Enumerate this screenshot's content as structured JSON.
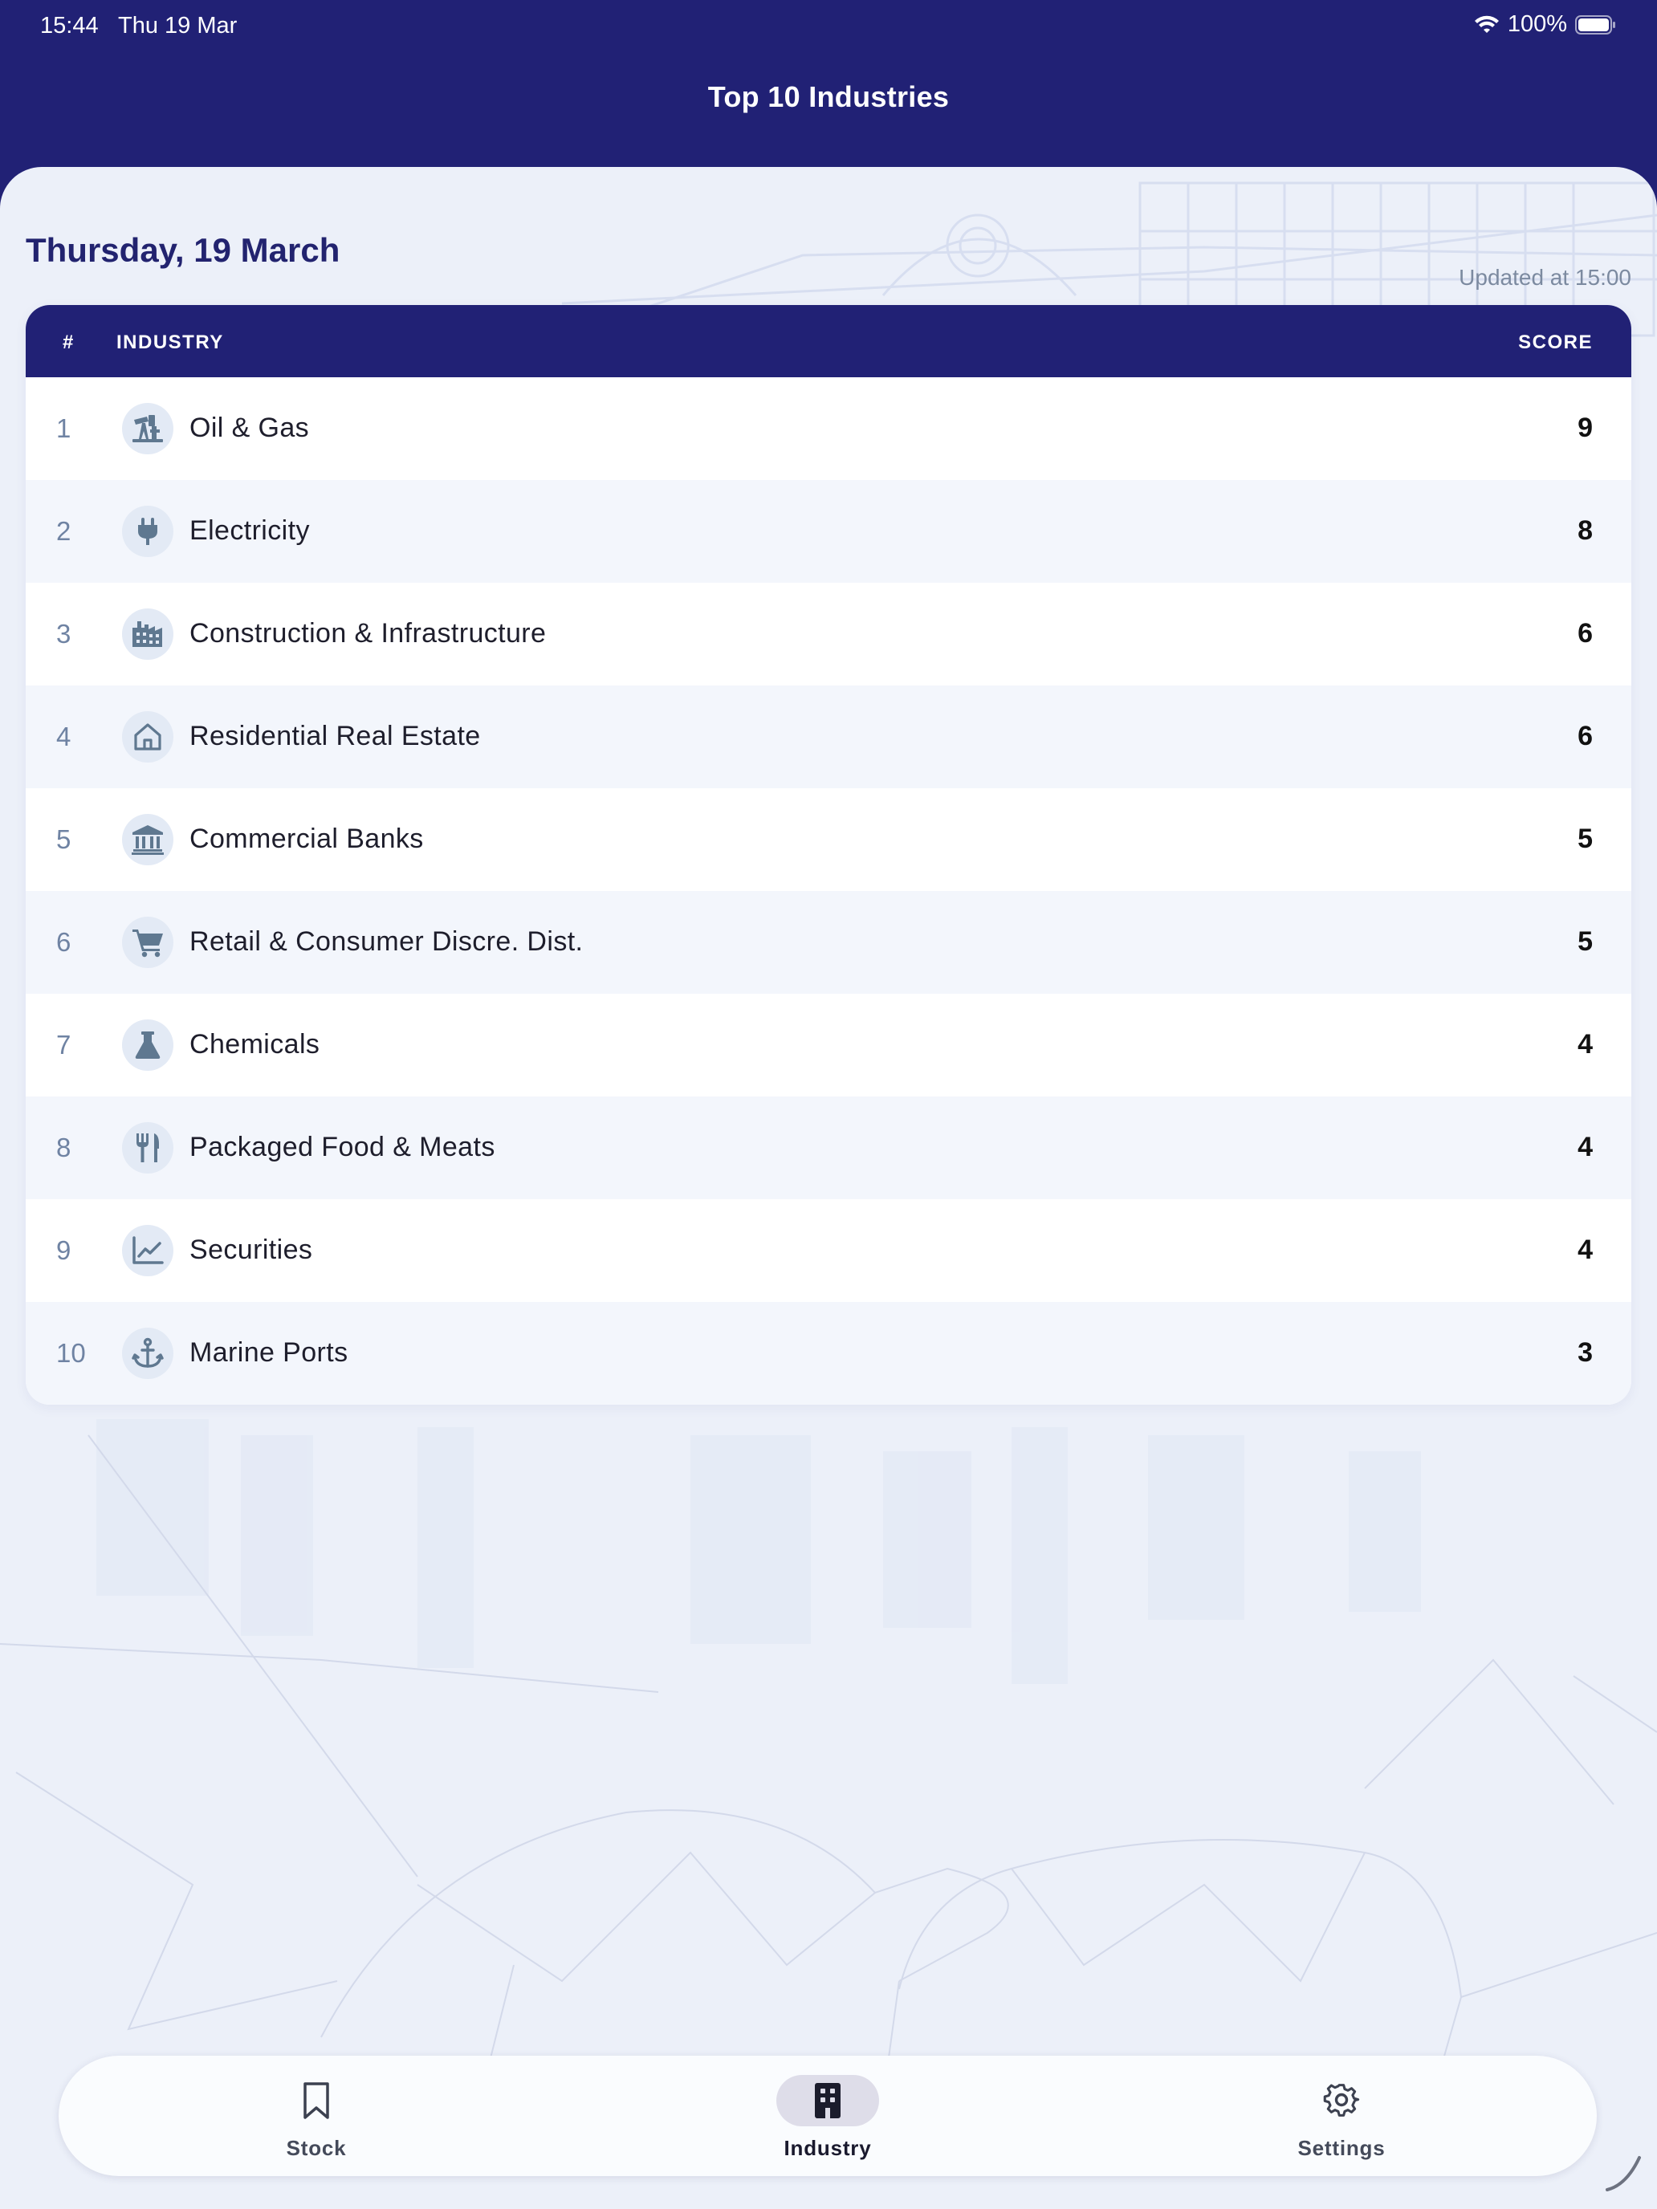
{
  "status_bar": {
    "time": "15:44",
    "date": "Thu 19 Mar",
    "battery": "100%"
  },
  "nav": {
    "title": "Top 10 Industries"
  },
  "header": {
    "date": "Thursday, 19 March",
    "updated": "Updated at 15:00"
  },
  "table": {
    "columns": {
      "rank": "#",
      "industry": "INDUSTRY",
      "score": "SCORE"
    },
    "rows": [
      {
        "rank": "1",
        "name": "Oil & Gas",
        "score": "9",
        "icon": "oil-pump-icon"
      },
      {
        "rank": "2",
        "name": "Electricity",
        "score": "8",
        "icon": "plug-icon"
      },
      {
        "rank": "3",
        "name": "Construction & Infrastructure",
        "score": "6",
        "icon": "factory-icon"
      },
      {
        "rank": "4",
        "name": "Residential Real Estate",
        "score": "6",
        "icon": "house-icon"
      },
      {
        "rank": "5",
        "name": "Commercial Banks",
        "score": "5",
        "icon": "bank-icon"
      },
      {
        "rank": "6",
        "name": "Retail & Consumer Discre. Dist.",
        "score": "5",
        "icon": "cart-icon"
      },
      {
        "rank": "7",
        "name": "Chemicals",
        "score": "4",
        "icon": "flask-icon"
      },
      {
        "rank": "8",
        "name": "Packaged Food & Meats",
        "score": "4",
        "icon": "utensils-icon"
      },
      {
        "rank": "9",
        "name": "Securities",
        "score": "4",
        "icon": "chart-line-icon"
      },
      {
        "rank": "10",
        "name": "Marine Ports",
        "score": "3",
        "icon": "anchor-icon"
      }
    ]
  },
  "tabbar": {
    "tabs": [
      {
        "label": "Stock",
        "icon": "bookmark-icon",
        "active": false
      },
      {
        "label": "Industry",
        "icon": "building-icon",
        "active": true
      },
      {
        "label": "Settings",
        "icon": "gear-icon",
        "active": false
      }
    ]
  },
  "colors": {
    "brand": "#212175",
    "background": "#ecf0f9",
    "row_alt": "#f3f6fc",
    "icon": "#5f7890",
    "rank": "#6f83a3"
  }
}
